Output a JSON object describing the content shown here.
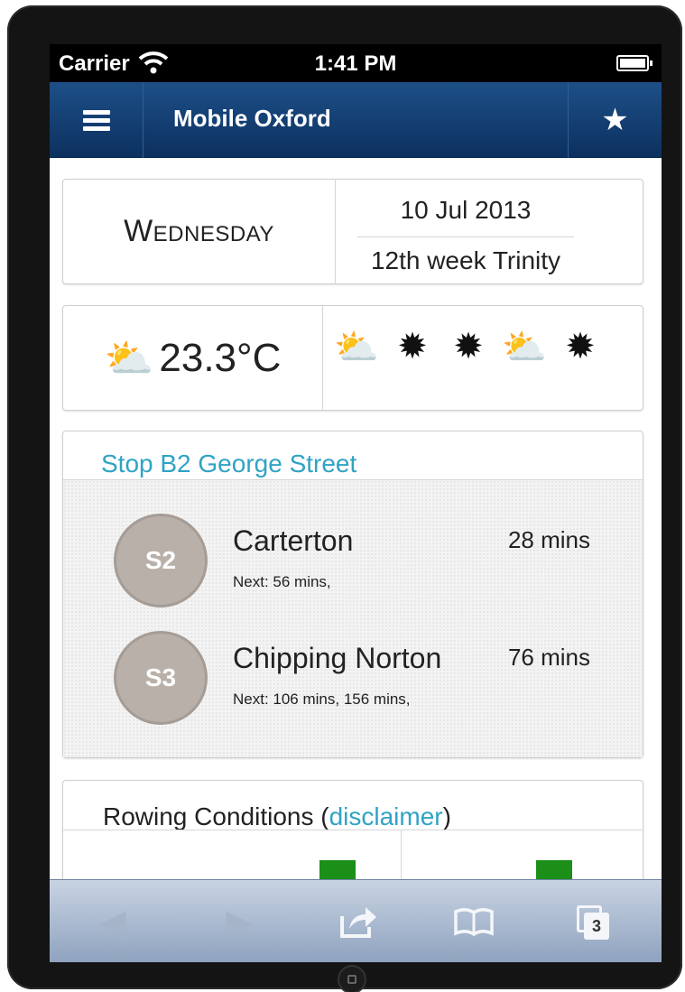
{
  "status_bar": {
    "carrier": "Carrier",
    "time": "1:41 PM",
    "wifi_icon": "wifi-icon",
    "battery_icon": "battery-icon"
  },
  "nav": {
    "title": "Mobile Oxford",
    "menu_icon": "hamburger-icon",
    "favourite_icon": "star-icon"
  },
  "date_card": {
    "day": "Wednesday",
    "date": "10 Jul 2013",
    "term_week": "12th week Trinity"
  },
  "weather": {
    "current_icon": "sun-behind-cloud-icon",
    "current_temp": "23.3°C",
    "forecast_icons": [
      "sun-behind-cloud-icon",
      "sun-icon",
      "sun-icon",
      "sun-behind-cloud-icon",
      "sun-icon"
    ]
  },
  "bus_stop": {
    "name": "Stop B2 George Street",
    "routes": [
      {
        "badge": "S2",
        "destination": "Carterton",
        "due": "28 mins",
        "next": "Next: 56 mins,"
      },
      {
        "badge": "S3",
        "destination": "Chipping Norton",
        "due": "76 mins",
        "next": "Next: 106 mins, 156 mins,"
      }
    ]
  },
  "rowing": {
    "title": "Rowing Conditions (",
    "disclaimer_link": "disclaimer",
    "title_end": ")",
    "flag_color": "#1b8f18"
  },
  "toolbar": {
    "tab_count": "3"
  },
  "colors": {
    "nav_blue": "#0c3160",
    "link_teal": "#2fa3c4",
    "badge_grey": "#b9b0a9"
  }
}
